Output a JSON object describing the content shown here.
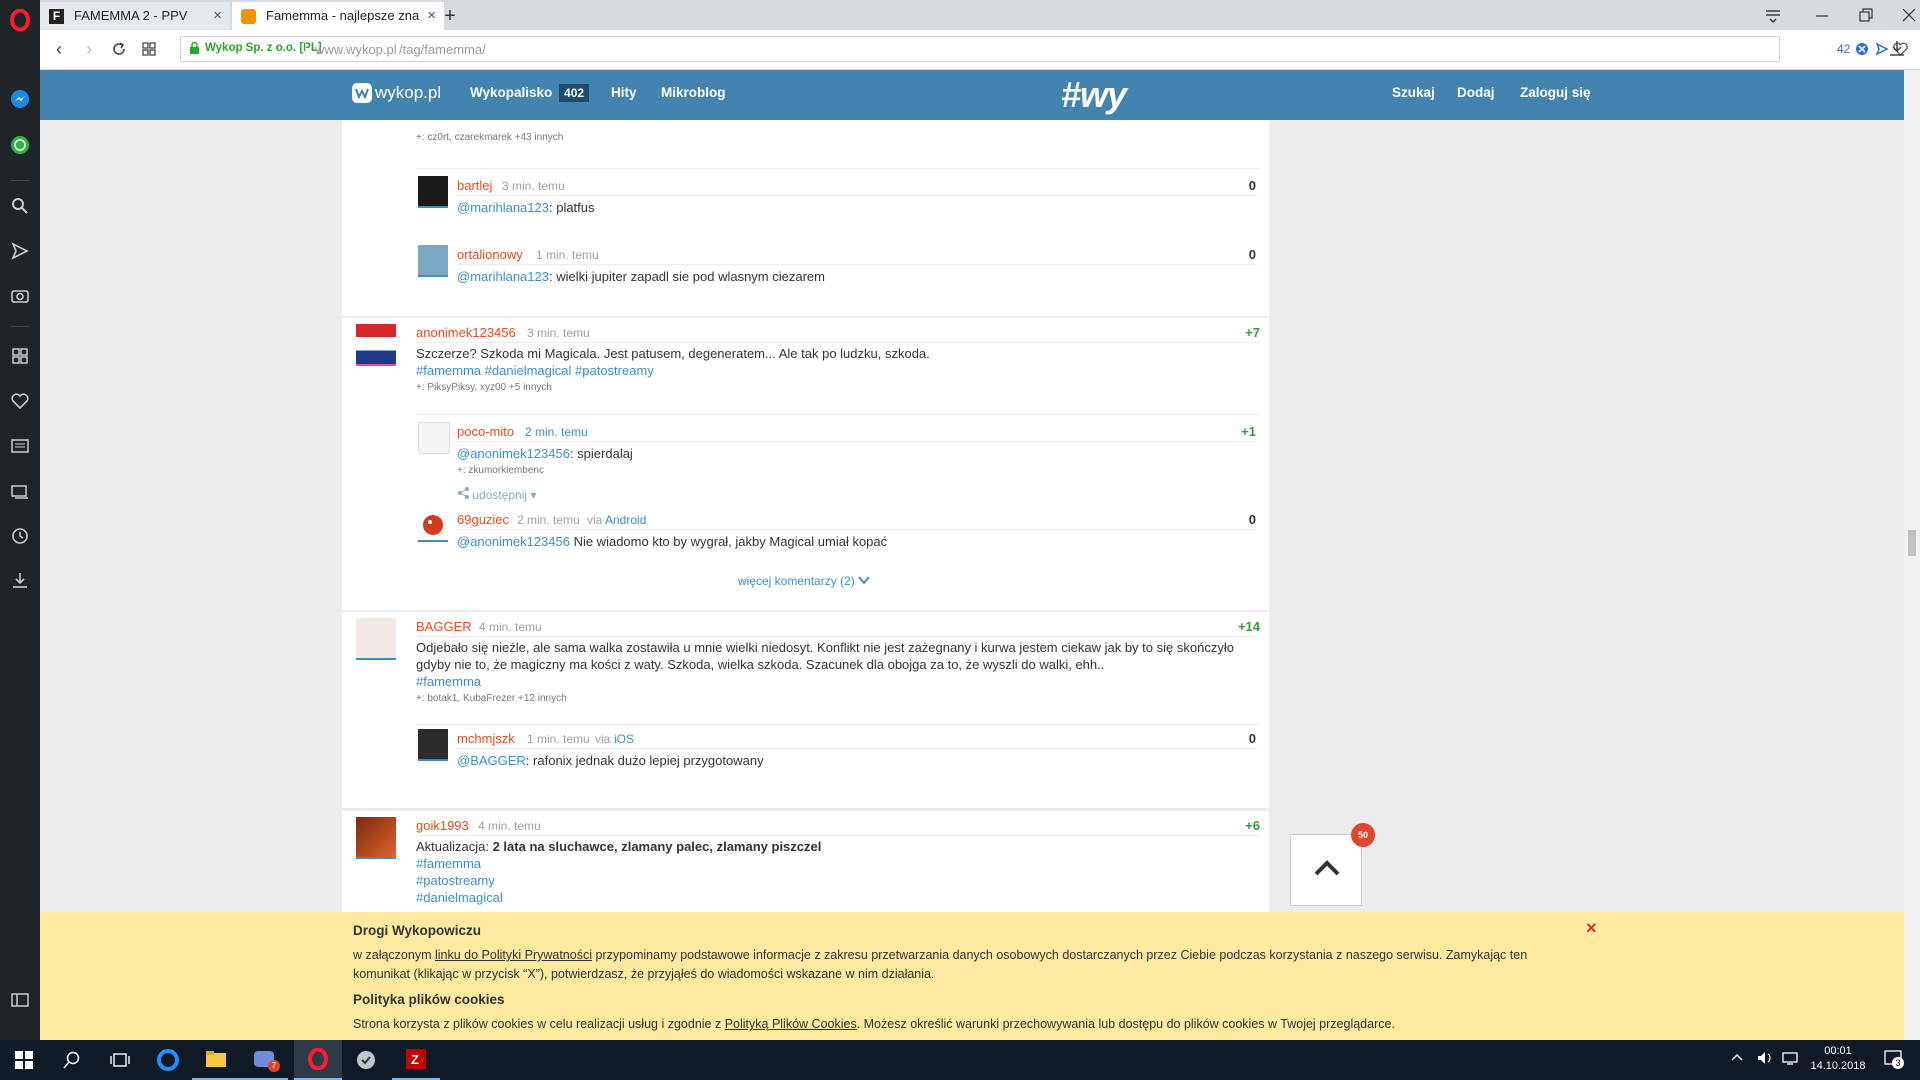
{
  "browser": {
    "tabs": [
      {
        "title": "FAMEMMA 2 - PPV",
        "favicon": "f-icon"
      },
      {
        "title": "Famemma - najlepsze zna",
        "favicon": "wykop-icon"
      }
    ],
    "new_tab": "+",
    "url_host": "www.wykop.pl",
    "url_path": "/tag/famemma/",
    "security_label": "Wykop Sp. z o.o. [PL]",
    "badge_count": "42"
  },
  "site": {
    "logo_text": "wykop.pl",
    "nav": [
      {
        "label": "Wykopalisko",
        "badge": "402"
      },
      {
        "label": "Hity"
      },
      {
        "label": "Mikroblog"
      }
    ],
    "right_nav": [
      "Szukaj",
      "Dodaj",
      "Zaloguj się"
    ],
    "center_logo": "#wy"
  },
  "entries": [
    {
      "plus_line": "+: cz0rt, czarekmarek +43 innych",
      "comments": [
        {
          "user": "bartlej",
          "time": "3 min. temu",
          "score": "0",
          "mention": "@marihlana123",
          "text": ": platfus"
        },
        {
          "user": "ortalionowy",
          "time": "1 min. temu",
          "score": "0",
          "mention": "@marihlana123",
          "text": ": wielki jupiter zapadl sie pod wlasnym ciezarem"
        }
      ]
    },
    {
      "user": "anonimek123456",
      "time": "3 min. temu",
      "score": "+7",
      "text": "Szczerze? Szkoda mi Magicala. Jest patusem, degeneratem... Ale tak po ludzku, szkoda.",
      "tags": [
        "#famemma",
        "#danielmagical",
        "#patostreamy"
      ],
      "plus_line": "+: PiksyPiksy, xyz00 +5 innych",
      "comments": [
        {
          "user": "poco-mito",
          "time": "2 min. temu",
          "score": "+1",
          "mention": "@anonimek123456",
          "text": ": spierdalaj",
          "plus_line": "+: zkumorkiembenc",
          "share": "udostępnij"
        },
        {
          "user": "69guziec",
          "time": "2 min. temu",
          "via": "via",
          "via_app": "Android",
          "score": "0",
          "mention": "@anonimek123456",
          "text": " Nie wiadomo kto by wygrał, jakby Magical umiał kopać"
        }
      ],
      "more_comments": "więcej komentarzy (2)"
    },
    {
      "user": "BAGGER",
      "time": "4 min. temu",
      "score": "+14",
      "text_lines": [
        "Odjebało się nieźle, ale sama walka zostawiła u mnie wielki niedosyt. Konflikt nie jest zażegnany i kurwa jestem ciekaw jak by to się skończyło",
        "gdyby nie to, że magiczny ma kości z waty. Szkoda, wielka szkoda. Szacunek dla obojga za to, że wyszli do walki, ehh.."
      ],
      "tags": [
        "#famemma"
      ],
      "plus_line": "+: botak1, KubaFrezer +12 innych",
      "comments": [
        {
          "user": "mchmjszk",
          "time": "1 min. temu",
          "via": "via",
          "via_app": "iOS",
          "score": "0",
          "mention": "@BAGGER",
          "text": ": rafonix jednak dużo lepiej przygotowany"
        }
      ]
    },
    {
      "user": "goik1993",
      "time": "4 min. temu",
      "score": "+6",
      "text_prefix": "Aktualizacja: ",
      "text_bold": "2 lata na sluchawce, zlamany palec, zlamany piszczel",
      "tags": [
        "#famemma",
        "#patostreamy",
        "#danielmagical"
      ]
    }
  ],
  "scroll_top": {
    "badge": "50"
  },
  "cookie_banner": {
    "title1": "Drogi Wykopowiczu",
    "line1_pre": "w załączonym ",
    "line1_link": "linku do Polityki Prywatności",
    "line1_post": " przypominamy podstawowe informacje z zakresu przetwarzania danych osobowych dostarczanych przez Ciebie podczas korzystania z naszego serwisu. Zamykając ten",
    "line2": "komunikat (klikając w przycisk “X”), potwierdzasz, że przyjąłeś do wiadomości wskazane w nim działania.",
    "title2": "Polityka plików cookies",
    "line3_pre": "Strona korzysta z plików cookies w celu realizacji usług i zgodnie z ",
    "line3_link": "Polityką Plików Cookies",
    "line3_post": ". Możesz określić warunki przechowywania lub dostępu do plików cookies w Twojej przeglądarce.",
    "close": "×"
  },
  "taskbar": {
    "time": "00:01",
    "date": "14.10.2018",
    "notif": "3",
    "app_badge": "7"
  }
}
